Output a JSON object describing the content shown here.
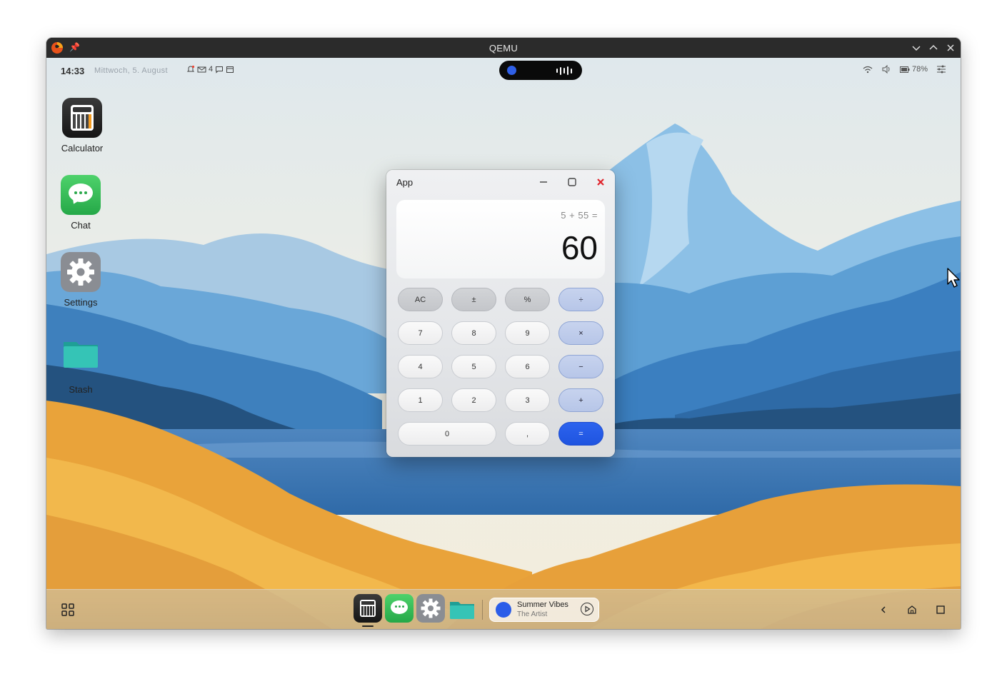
{
  "qemu": {
    "title": "QEMU"
  },
  "statusbar": {
    "time": "14:33",
    "date": "Mittwoch, 5. August",
    "mail_count": "4",
    "battery": "78%"
  },
  "desktop_icons": [
    {
      "label": "Calculator",
      "icon": "calculator-icon"
    },
    {
      "label": "Chat",
      "icon": "chat-icon"
    },
    {
      "label": "Settings",
      "icon": "gear-icon"
    },
    {
      "label": "Stash",
      "icon": "folder-icon"
    }
  ],
  "calculator": {
    "window_title": "App",
    "expression": "5 + 55 =",
    "result": "60",
    "keys": {
      "ac": "AC",
      "plusminus": "±",
      "percent": "%",
      "divide": "÷",
      "seven": "7",
      "eight": "8",
      "nine": "9",
      "multiply": "×",
      "four": "4",
      "five": "5",
      "six": "6",
      "minus": "−",
      "one": "1",
      "two": "2",
      "three": "3",
      "plus": "+",
      "zero": "0",
      "comma": ",",
      "equals": "="
    }
  },
  "taskbar": {
    "media": {
      "title": "Summer Vibes",
      "artist": "The Artist"
    }
  },
  "colors": {
    "accent": "#1f54e0",
    "operator_key": "#b7c6e8",
    "chat_green": "#34c759",
    "folder_teal": "#2bb3a8"
  }
}
